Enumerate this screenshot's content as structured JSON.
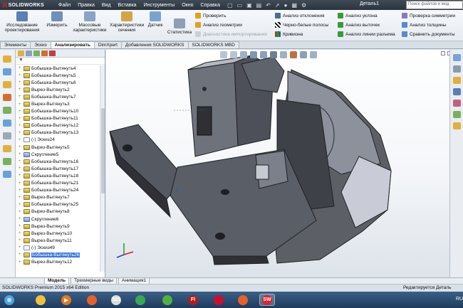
{
  "app": {
    "logo_text": "SOLIDWORKS",
    "doc_title": "Деталь1",
    "search_placeholder": "Поиск файлов и мод"
  },
  "menu": [
    "Файл",
    "Правка",
    "Вид",
    "Вставка",
    "Инструменты",
    "Окно",
    "Справка"
  ],
  "ribbon": {
    "big_buttons": [
      {
        "label": "Исследование проектирования",
        "icon": "design-study-icon",
        "color": "#5a7fb0"
      },
      {
        "label": "Измерить",
        "icon": "measure-icon",
        "color": "#6f8fb8"
      },
      {
        "label": "Массовые характеристики",
        "icon": "mass-properties-icon",
        "color": "#8aa3c6"
      },
      {
        "label": "Характеристики сечения",
        "icon": "section-properties-icon",
        "color": "#d3a54a"
      },
      {
        "label": "Датчик",
        "icon": "sensor-icon",
        "color": "#7aa4d0"
      },
      {
        "label": "Статистика",
        "icon": "statistics-icon",
        "color": "#8e9fb5"
      }
    ],
    "check_group": [
      {
        "label": "Проверить",
        "disabled": false
      },
      {
        "label": "Анализ геометрии",
        "disabled": false
      },
      {
        "label": "Диагностика импортирования",
        "disabled": true
      }
    ],
    "analysis_col1": [
      "Анализ отклонения",
      "Черно-белые полосы",
      "Кривизна"
    ],
    "analysis_col2": [
      "Анализ уклона",
      "Анализ выточек",
      "Анализ линии разъема"
    ],
    "analysis_col3": [
      "Проверка симметрии",
      "Анализ толщины",
      "Сравнить документы"
    ]
  },
  "tabs": [
    "Элементы",
    "Эскиз",
    "Анализировать",
    "DimXpert",
    "Добавления SOLIDWORKS",
    "SOLIDWORKS MBD"
  ],
  "active_tab": "Анализировать",
  "tree": {
    "filter_icon": "filter-icon",
    "items": [
      {
        "label": "Бобышка-Вытянуть4",
        "kind": "feat"
      },
      {
        "label": "Бобышка-Вытянуть5",
        "kind": "feat"
      },
      {
        "label": "Бобышка-Вытянуть6",
        "kind": "feat"
      },
      {
        "label": "Вырез-Вытянуть2",
        "kind": "feat"
      },
      {
        "label": "Бобышка-Вытянуть7",
        "kind": "feat"
      },
      {
        "label": "Вырез-Вытянуть3",
        "kind": "feat"
      },
      {
        "label": "Бобышка-Вытянуть10",
        "kind": "feat"
      },
      {
        "label": "Бобышка-Вытянуть11",
        "kind": "feat"
      },
      {
        "label": "Бобышка-Вытянуть12",
        "kind": "feat"
      },
      {
        "label": "Бобышка-Вытянуть13",
        "kind": "feat"
      },
      {
        "label": "(-) Эскиз24",
        "kind": "sk"
      },
      {
        "label": "Вырез-Вытянуть5",
        "kind": "feat"
      },
      {
        "label": "Скругление5",
        "kind": "fil"
      },
      {
        "label": "Бобышка-Вытянуть16",
        "kind": "feat"
      },
      {
        "label": "Бобышка-Вытянуть17",
        "kind": "feat"
      },
      {
        "label": "Бобышка-Вытянуть18",
        "kind": "feat"
      },
      {
        "label": "Бобышка-Вытянуть21",
        "kind": "feat"
      },
      {
        "label": "Бобышка-Вытянуть24",
        "kind": "feat"
      },
      {
        "label": "Вырез-Вытянуть7",
        "kind": "feat"
      },
      {
        "label": "Бобышка-Вытянуть25",
        "kind": "feat"
      },
      {
        "label": "Вырез-Вытянуть8",
        "kind": "feat"
      },
      {
        "label": "Скругление6",
        "kind": "fil"
      },
      {
        "label": "Вырез-Вытянуть9",
        "kind": "feat"
      },
      {
        "label": "Вырез-Вытянуть10",
        "kind": "feat"
      },
      {
        "label": "Вырез-Вытянуть11",
        "kind": "feat"
      },
      {
        "label": "(-) Эскиз49",
        "kind": "sk"
      },
      {
        "label": "Бобышка-Вытянуть26",
        "kind": "feat",
        "selected": true
      },
      {
        "label": "Вырез-Вытянуть12",
        "kind": "feat"
      }
    ]
  },
  "bottom_tabs": [
    "Модель",
    "Трехмерные виды",
    "Анимация1"
  ],
  "status": {
    "left": "SOLIDWORKS Premium 2015 x64 Edition",
    "right": "Редактируется Деталь"
  },
  "taskbar": {
    "items": [
      {
        "name": "start-button",
        "glyph": "⊞",
        "color": "#4aa3df"
      },
      {
        "name": "file-explorer-icon",
        "glyph": "",
        "color": "#f0c040"
      },
      {
        "name": "media-player-icon",
        "glyph": "▶",
        "color": "#e07a20"
      },
      {
        "name": "firefox-icon",
        "glyph": "",
        "color": "#e5622c"
      },
      {
        "name": "calendar-app-icon",
        "glyph": "321",
        "color": "#dcdcdc"
      },
      {
        "name": "chrome-icon",
        "glyph": "",
        "color": "#3aa757"
      },
      {
        "name": "xbox-icon",
        "glyph": "",
        "color": "#52b043"
      },
      {
        "name": "flash-icon",
        "glyph": "Fl",
        "color": "#b01e1e"
      },
      {
        "name": "adobe-app-icon",
        "glyph": "",
        "color": "#c8102e"
      },
      {
        "name": "firefox-icon-2",
        "glyph": "",
        "color": "#e5622c"
      },
      {
        "name": "solidworks-taskbar-icon",
        "glyph": "SW",
        "color": "#d8242f"
      }
    ],
    "tray_lang": "RU"
  }
}
